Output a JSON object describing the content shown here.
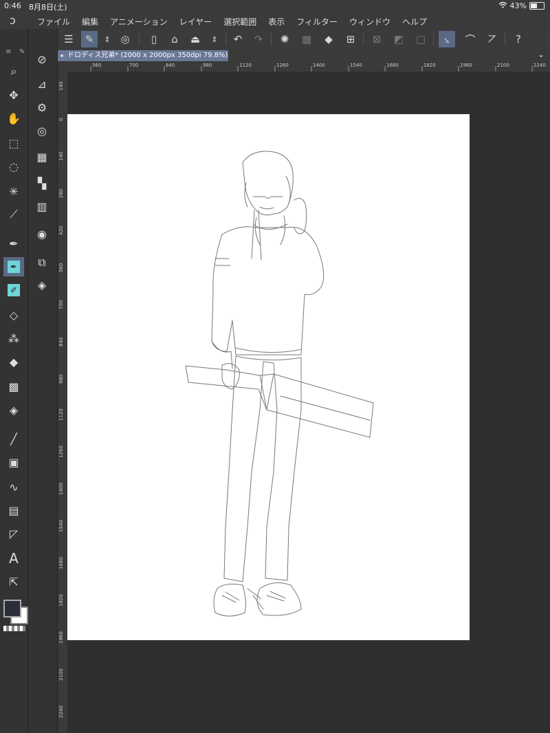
{
  "status": {
    "time": "0:46",
    "date": "8月8日(土)",
    "battery": "43%"
  },
  "menu": {
    "items": [
      "ファイル",
      "編集",
      "アニメーション",
      "レイヤー",
      "選択範囲",
      "表示",
      "フィルター",
      "ウィンドウ",
      "ヘルプ"
    ]
  },
  "document": {
    "tab_label": "ドロディス兄弟* (2000 x 2000px 350dpi 79.8%)"
  },
  "ruler": {
    "h": [
      "560",
      "700",
      "840",
      "980",
      "1120",
      "1260",
      "1400",
      "1540",
      "1680",
      "1820",
      "1960",
      "2100",
      "2240"
    ],
    "v": [
      "140",
      "0",
      "140",
      "280",
      "420",
      "560",
      "700",
      "840",
      "980",
      "1120",
      "1260",
      "1400",
      "1540",
      "1680",
      "1820",
      "1960",
      "2100",
      "2240"
    ]
  },
  "colors": {
    "accent": "#5a6a86",
    "teal": "#6fd6d9",
    "panel": "#333333",
    "canvas": "#2f2f2f"
  },
  "icons": {
    "toolbar": [
      "menu-icon",
      "edit-icon",
      "stepper-icon",
      "spiral-icon",
      "new-file-icon",
      "open-folder-icon",
      "save-icon",
      "updown-icon",
      "undo-icon",
      "redo-icon",
      "loading-icon",
      "transform-icon",
      "fill-icon",
      "crop-icon",
      "deselect-icon",
      "invert-icon",
      "border-icon",
      "pen-stabilize-icon",
      "brush-icon",
      "ruler-icon",
      "help-icon"
    ],
    "tools": [
      "zoom-icon",
      "move-icon",
      "hand-icon",
      "object-select-icon",
      "lasso-icon",
      "magic-wand-icon",
      "eyedropper-icon",
      "pen-icon",
      "pen-active-icon",
      "pen-teal-icon",
      "eraser-icon",
      "airbrush-icon",
      "fill-bucket-icon",
      "pattern-icon",
      "blend-icon",
      "line-icon",
      "gradient-icon",
      "wave-icon",
      "layer-stack-icon",
      "triangle-icon",
      "text-icon",
      "pointer-icon"
    ]
  }
}
